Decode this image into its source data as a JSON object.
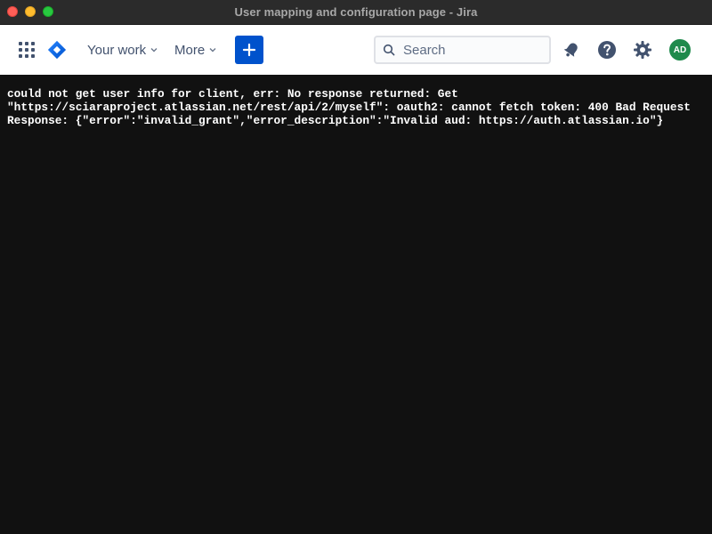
{
  "window": {
    "title": "User mapping and configuration page - Jira"
  },
  "topnav": {
    "app_switcher_icon": "app-grid-icon",
    "logo_icon": "jira-logo-icon",
    "your_work_label": "Your work",
    "more_label": "More",
    "create_icon": "plus-icon",
    "search": {
      "placeholder": "Search",
      "value": ""
    },
    "notifications_icon": "bell-icon",
    "help_icon": "help-icon",
    "settings_icon": "gear-icon",
    "avatar_initials": "AD"
  },
  "colors": {
    "primary": "#0052cc",
    "nav_text": "#42526e",
    "avatar": "#1f8a4c",
    "content_bg": "#111111"
  },
  "error": {
    "lines": [
      "could not get user info for client, err: No response returned: Get",
      "\"https://sciaraproject.atlassian.net/rest/api/2/myself\": oauth2: cannot fetch token: 400 Bad Request",
      "Response: {\"error\":\"invalid_grant\",\"error_description\":\"Invalid aud: https://auth.atlassian.io\"}"
    ]
  }
}
